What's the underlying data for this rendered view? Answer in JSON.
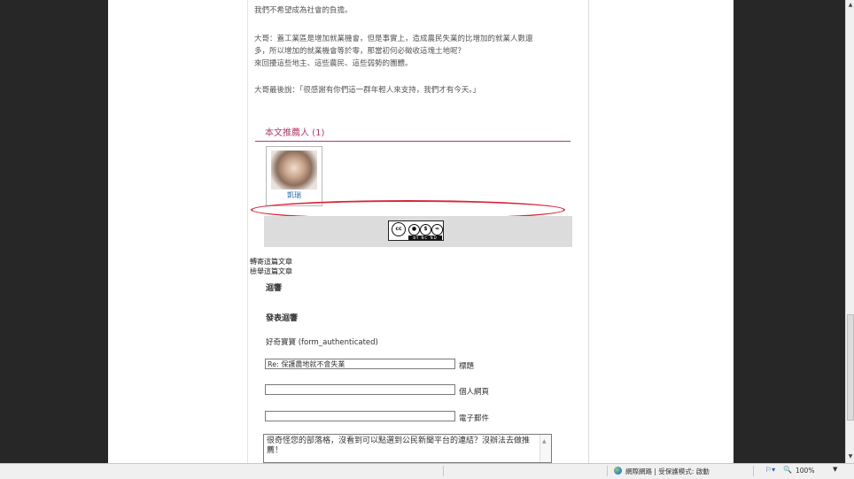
{
  "article": {
    "lines": [
      "我們不希望成為社會的負擔。",
      "",
      "大哥：蓋工業區是增加就業機會，但是事實上，造成農民失業的比增加的就業人數還",
      "多，所以增加的就業機會等於零，那當初何必徵收這塊土地呢？",
      "來回擾這些地主、這些農民、這些弱勢的團體。",
      "",
      "大哥最後說：「很感謝有你們這一群年輕人來支持，我們才有今天。」"
    ]
  },
  "recommenders": {
    "title": "本文推薦人 (1)",
    "items": [
      {
        "name": "凱瑞"
      }
    ]
  },
  "license": {
    "strip_text": "BY NC ND",
    "cc_label": "cc"
  },
  "links": {
    "forward": "轉寄這篇文章",
    "report": "檢舉這篇文章"
  },
  "responses": {
    "heading": "迴響",
    "post_heading": "發表迴響"
  },
  "form": {
    "user": "好奇寶寶 (form_authenticated)",
    "title_value": "Re: 保護農地就不會失業",
    "title_label": "標題",
    "homepage_value": "",
    "homepage_label": "個人網頁",
    "email_value": "",
    "email_label": "電子郵件",
    "comment_value": "很奇怪您的部落格，沒看到可以點選到公民新聞平台的連結？沒辦法去做推薦！"
  },
  "statusbar": {
    "zone": "網際網路 | 受保護模式: 啟動",
    "zoom": "100%"
  }
}
